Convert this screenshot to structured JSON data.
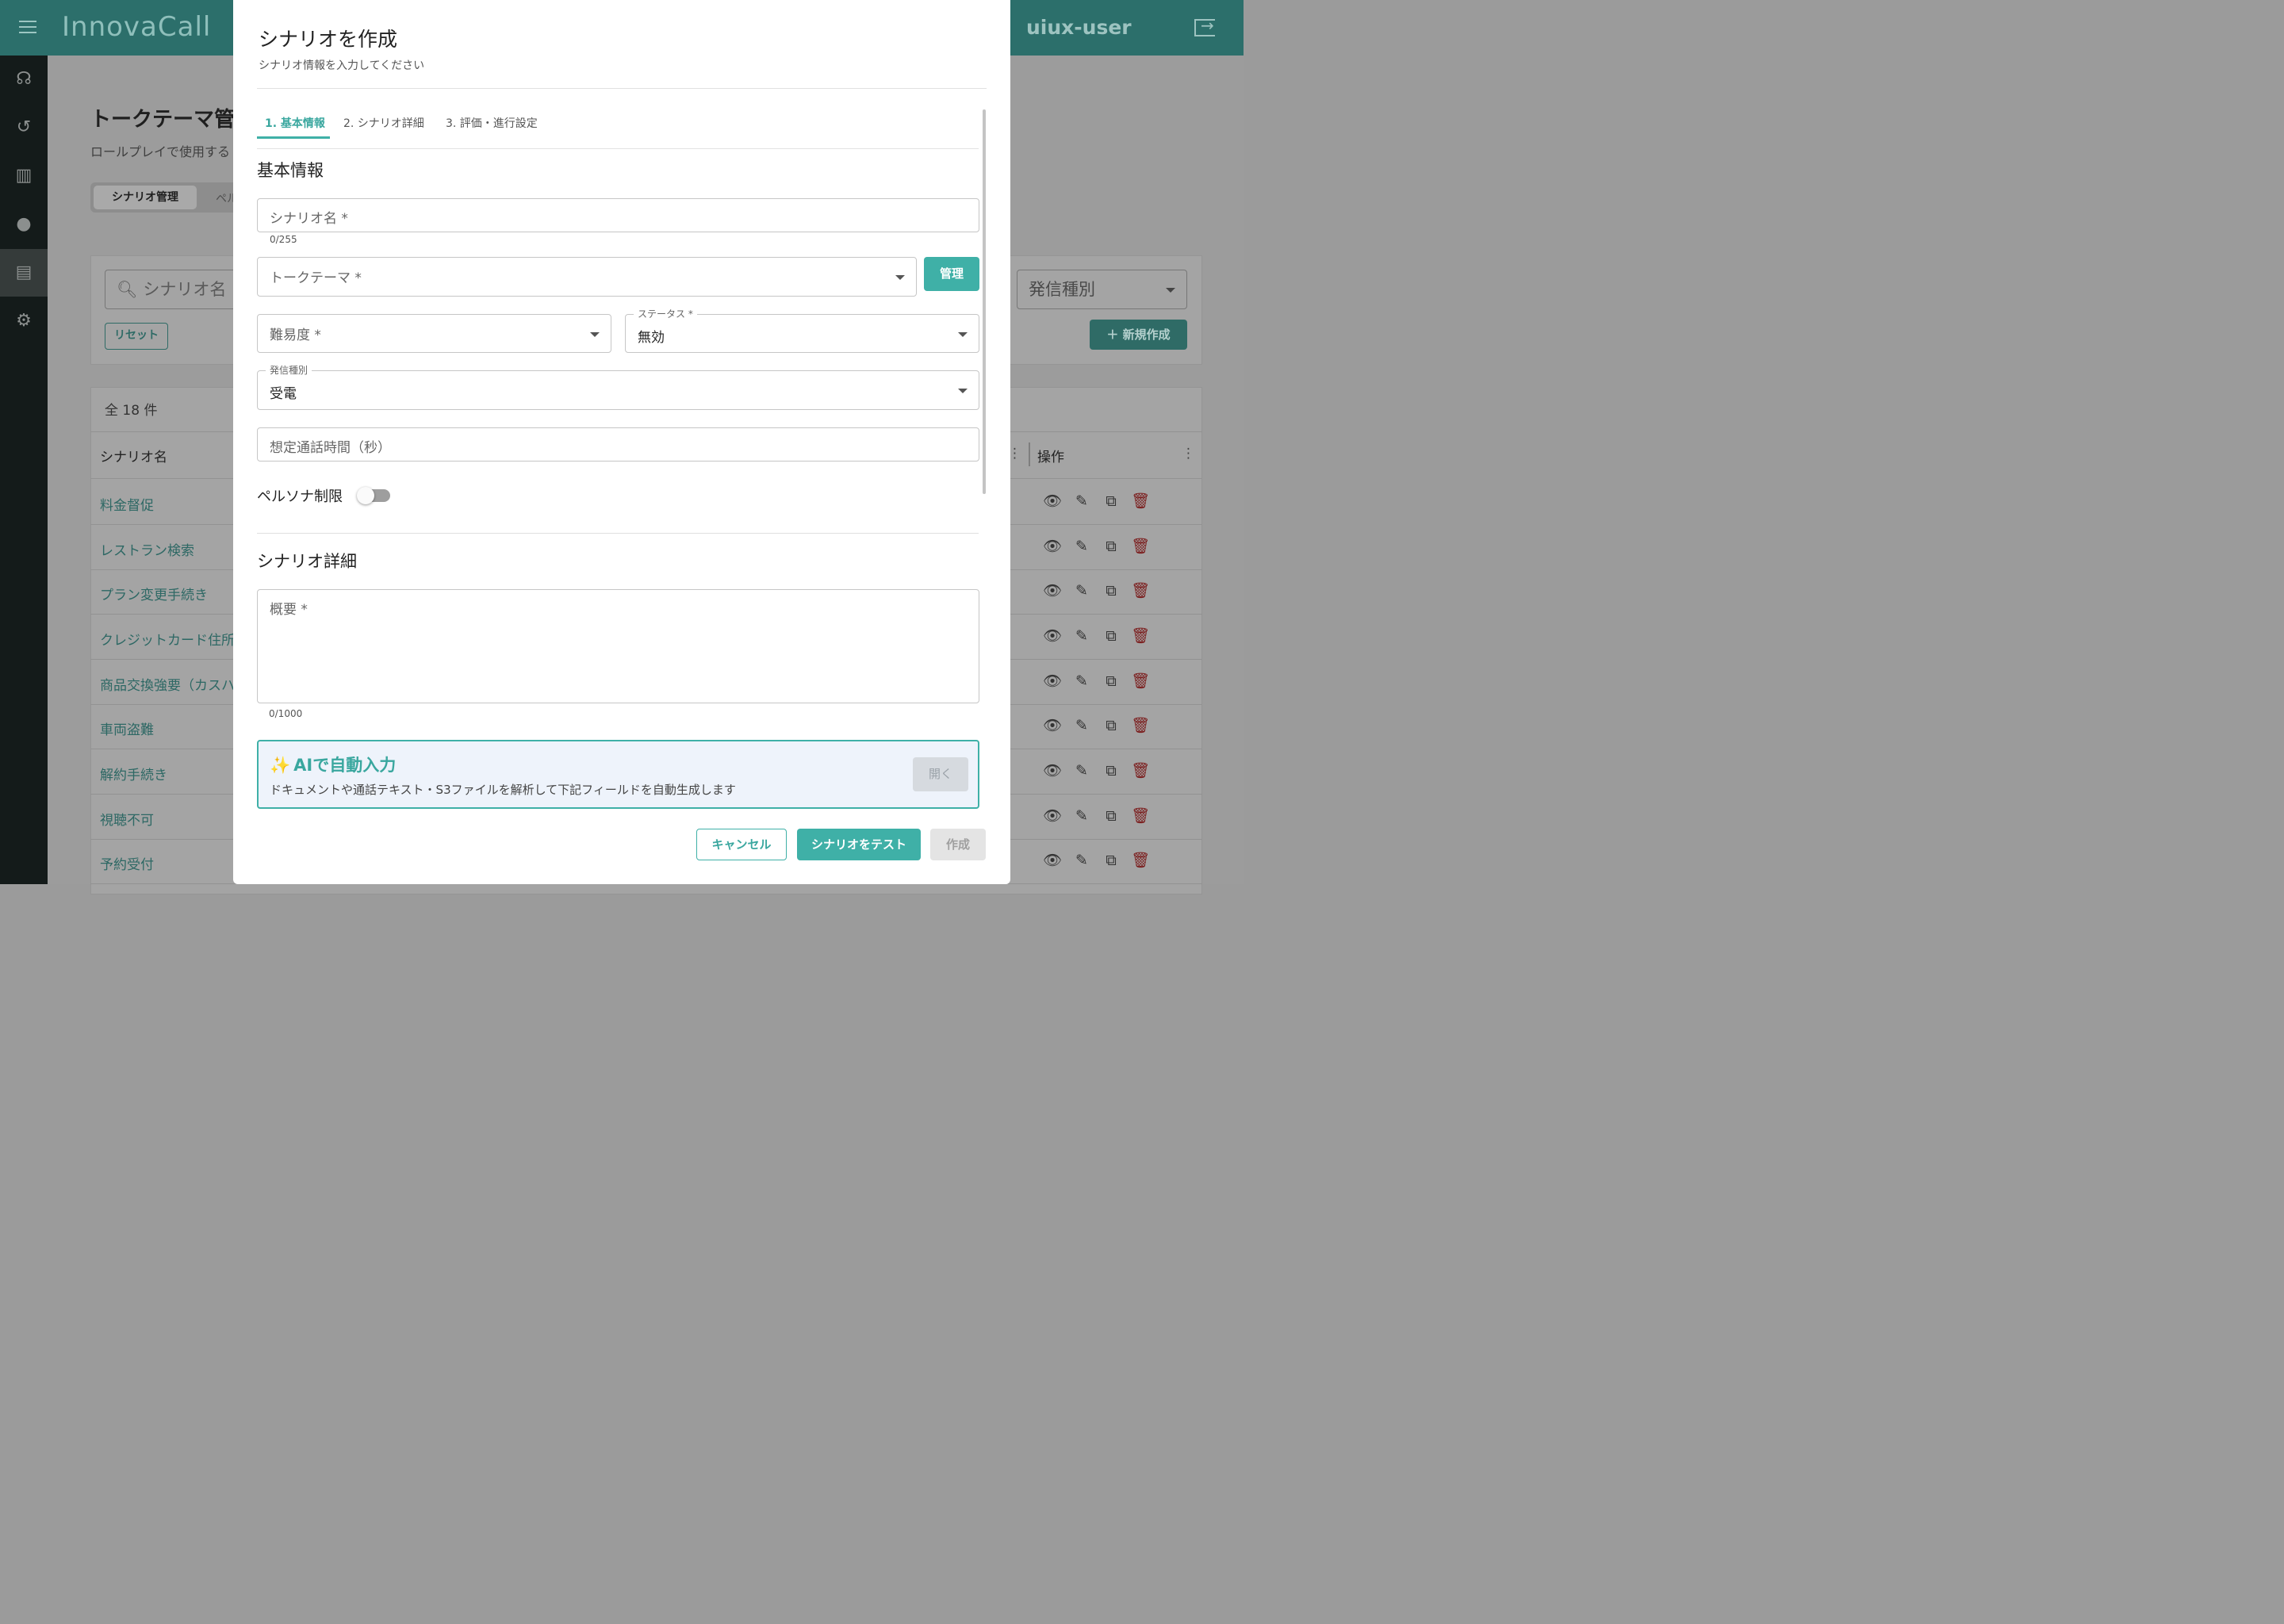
{
  "app": {
    "logo": "InnovaCall",
    "username": "uiux-user",
    "sidebar_icons": [
      "headset-icon",
      "history-icon",
      "chart-icon",
      "person-icon",
      "chat-icon",
      "gear-icon"
    ]
  },
  "background": {
    "page_title": "トークテーマ管",
    "page_subtitle": "ロールプレイで使用する",
    "tabs": [
      "シナリオ管理",
      "ペル"
    ],
    "search_placeholder": "シナリオ名",
    "reset_label": "リセット",
    "call_type_filter": "発信種別",
    "new_button": "＋ 新規作成",
    "count": "全 18 件",
    "columns": [
      "シナリオ名",
      "操作"
    ],
    "rows": [
      "料金督促",
      "レストラン検索",
      "プラン変更手続き",
      "クレジットカード住所",
      "商品交換強要（カスハ",
      "車両盗難",
      "解約手続き",
      "視聴不可",
      "予約受付"
    ]
  },
  "modal": {
    "title": "シナリオを作成",
    "subtitle": "シナリオ情報を入力してください",
    "tabs": [
      "1. 基本情報",
      "2. シナリオ詳細",
      "3. 評価・進行設定"
    ],
    "basic_section_title": "基本情報",
    "scenario_name": {
      "label": "シナリオ名 *",
      "value": "",
      "counter": "0/255"
    },
    "talk_theme": {
      "label": "トークテーマ *",
      "value": ""
    },
    "manage_button": "管理",
    "difficulty": {
      "label": "難易度 *",
      "value": ""
    },
    "status": {
      "label": "ステータス *",
      "value": "無効"
    },
    "call_type": {
      "label": "発信種別",
      "value": "受電"
    },
    "expected_duration": {
      "label": "想定通話時間（秒）",
      "value": ""
    },
    "persona_limit": {
      "label": "ペルソナ制限",
      "enabled": false
    },
    "detail_section_title": "シナリオ詳細",
    "overview": {
      "label": "概要 *",
      "value": "",
      "counter": "0/1000"
    },
    "ai": {
      "spark": "✨",
      "title": "AIで自動入力",
      "description": "ドキュメントや通話テキスト・S3ファイルを解析して下記フィールドを自動生成します",
      "open_button": "開く"
    },
    "buttons": {
      "cancel": "キャンセル",
      "test": "シナリオをテスト",
      "create": "作成"
    }
  },
  "colors": {
    "accent": "#3fb0a7",
    "topbar": "#2c6f6b",
    "sidebar": "#141b1a",
    "danger": "#7b1c1c"
  }
}
